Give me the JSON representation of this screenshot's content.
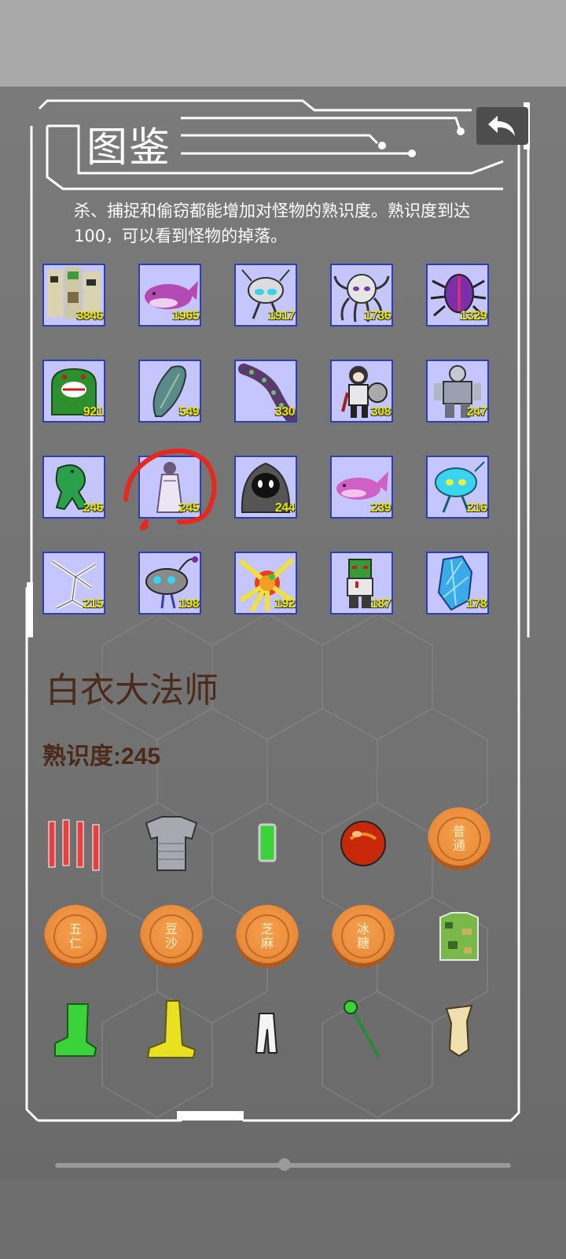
{
  "header": {
    "title": "图鉴"
  },
  "description": "杀、捕捉和偷窃都能增加对怪物的熟识度。熟识度到达100，可以看到怪物的掉落。",
  "monsters": [
    {
      "count": "3846",
      "icon": "stone-golem-group-icon"
    },
    {
      "count": "1965",
      "icon": "purple-whale-icon"
    },
    {
      "count": "1917",
      "icon": "gray-mech-alien-icon"
    },
    {
      "count": "1736",
      "icon": "gray-octopus-icon"
    },
    {
      "count": "1329",
      "icon": "purple-beetle-icon"
    },
    {
      "count": "921",
      "icon": "green-monster-icon"
    },
    {
      "count": "549",
      "icon": "feather-creature-icon"
    },
    {
      "count": "330",
      "icon": "tentacle-icon"
    },
    {
      "count": "308",
      "icon": "warrior-icon"
    },
    {
      "count": "247",
      "icon": "armored-knight-icon"
    },
    {
      "count": "246",
      "icon": "green-dinosaur-icon"
    },
    {
      "count": "245",
      "icon": "white-mage-icon"
    },
    {
      "count": "244",
      "icon": "hooded-ghost-icon"
    },
    {
      "count": "239",
      "icon": "pink-whale-icon"
    },
    {
      "count": "216",
      "icon": "cyan-alien-icon"
    },
    {
      "count": "215",
      "icon": "bone-creature-icon"
    },
    {
      "count": "198",
      "icon": "anglerfish-icon"
    },
    {
      "count": "192",
      "icon": "yellow-tentacle-icon"
    },
    {
      "count": "187",
      "icon": "zombie-icon"
    },
    {
      "count": "178",
      "icon": "blue-crystal-icon"
    }
  ],
  "selected": {
    "name": "白衣大法师",
    "familiarity_label": "熟识度:",
    "familiarity_value": "245"
  },
  "drops": [
    {
      "icon": "scrolls-icon"
    },
    {
      "icon": "chainmail-icon"
    },
    {
      "icon": "green-battery-icon"
    },
    {
      "icon": "red-orb-icon"
    },
    {
      "icon": "mooncake-icon",
      "l1": "普",
      "l2": "通"
    },
    {
      "icon": "mooncake-icon",
      "l1": "五",
      "l2": "仁"
    },
    {
      "icon": "mooncake-icon",
      "l1": "豆",
      "l2": "沙"
    },
    {
      "icon": "mooncake-icon",
      "l1": "芝",
      "l2": "麻"
    },
    {
      "icon": "mooncake-icon",
      "l1": "冰",
      "l2": "糖"
    },
    {
      "icon": "camo-vest-icon"
    },
    {
      "icon": "green-boot-icon"
    },
    {
      "icon": "yellow-boot-icon"
    },
    {
      "icon": "white-cloth-icon"
    },
    {
      "icon": "green-staff-icon"
    },
    {
      "icon": "beige-cloth-icon"
    }
  ],
  "colors": {
    "cell_bg": "#c5c5ff",
    "cell_border": "#2f3fb0",
    "count_text": "#e6e600",
    "name_text": "#4a2a1a",
    "annotation": "#e8281e"
  }
}
